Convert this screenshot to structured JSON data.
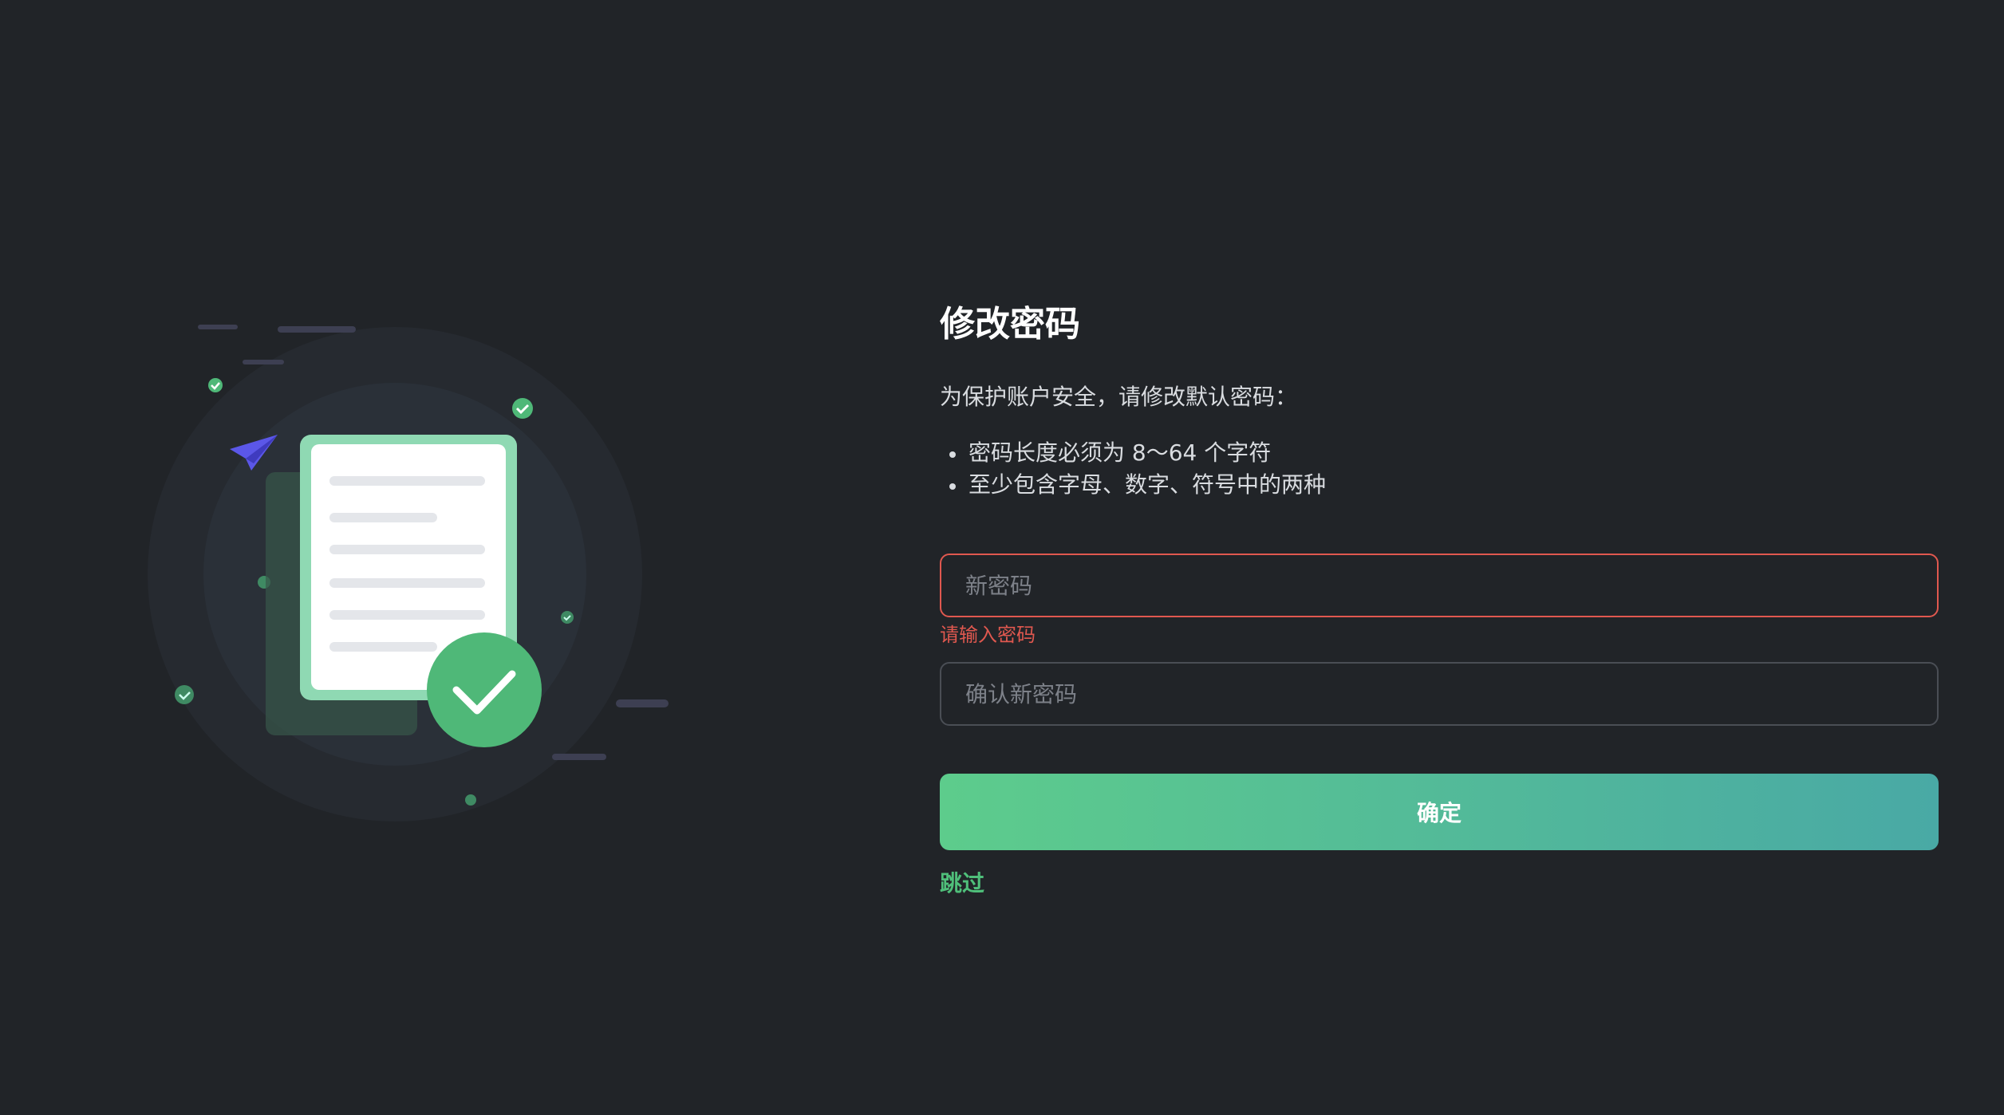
{
  "form": {
    "title": "修改密码",
    "description": "为保护账户安全，请修改默认密码：",
    "rules": [
      "密码长度必须为 8～64 个字符",
      "至少包含字母、数字、符号中的两种"
    ],
    "new_password": {
      "placeholder": "新密码",
      "value": "",
      "error": "请输入密码"
    },
    "confirm_password": {
      "placeholder": "确认新密码",
      "value": ""
    },
    "submit_label": "确定",
    "skip_label": "跳过"
  },
  "illustration": {
    "icons": [
      "paper-plane-icon",
      "document-icon",
      "check-circle-icon"
    ]
  },
  "colors": {
    "background": "#212428",
    "accent_green": "#5dcc8c",
    "accent_teal": "#49a9a5",
    "error": "#e0584f",
    "plane": "#5b57e8"
  }
}
